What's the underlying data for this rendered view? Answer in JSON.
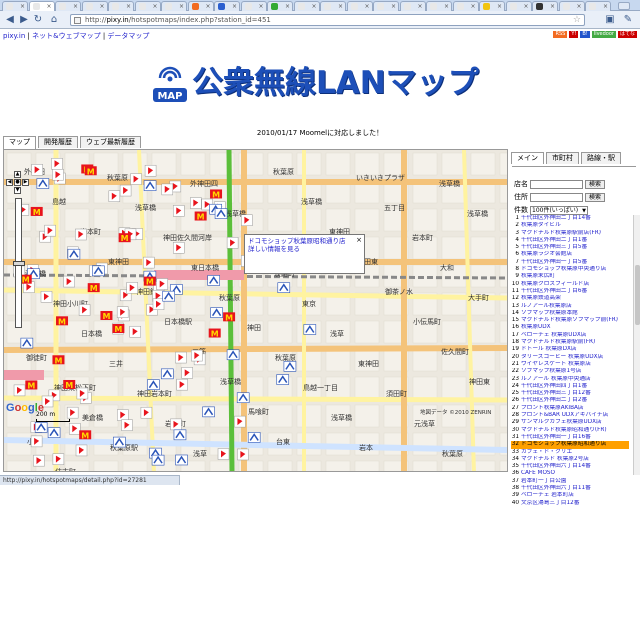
{
  "browser": {
    "tab_favicon_colors": [
      "#e8e8e8",
      "#e8e8e8",
      "#e8e8e8",
      "#e8e8e8",
      "#e8e8e8",
      "#e8e8e8",
      "#e8e8e8",
      "#f26b21",
      "#2b5fcf",
      "#e8e8e8",
      "#33aa33",
      "#e8e8e8",
      "#e8e8e8",
      "#e8e8e8",
      "#e8e8e8",
      "#e8e8e8",
      "#e8e8e8",
      "#e8e8e8",
      "#f1c40f",
      "#e8e8e8",
      "#333333",
      "#e8e8e8",
      "#e8e8e8"
    ],
    "active_tab_index": 1,
    "url_prefix": "http://",
    "url_host": "pixy.in",
    "url_path": "/hotspotmaps/index.php?station_id=451",
    "status_url": "http://pixy.in/hotspotmaps/detail.php?id=27281"
  },
  "site": {
    "links": [
      "pixy.in",
      "ネット&ウェブマップ",
      "データマップ"
    ],
    "badges": [
      {
        "label": "RSS",
        "color": "#f26b21"
      },
      {
        "label": "Y!",
        "color": "#cc0000"
      },
      {
        "label": "B!",
        "color": "#2255cc"
      },
      {
        "label": "livedoor",
        "color": "#44aa44"
      },
      {
        "label": "はてな",
        "color": "#cc0000"
      }
    ],
    "logo_badge": "MAP",
    "title": "公衆無線LANマップ",
    "notice": "2010/01/17 Moomelに対応しました！",
    "tabs": [
      "マップ",
      "開発履歴",
      "ウェブ最新履歴"
    ]
  },
  "map": {
    "infowindow": {
      "line1": "ドコモショップ秋葉原昭和通り店",
      "line2": "詳しい情報を見る",
      "close": "×"
    },
    "labels": [
      "外神田",
      "秋葉原",
      "外神田四",
      "秋葉原",
      "いきいきプラザ",
      "浅草橋",
      "島越",
      "浅草橋",
      "東浅草橋",
      "浅草橋",
      "五丁目",
      "浅草橋",
      "岩本町",
      "神田佐久間河岸",
      "神田岩本町",
      "東神田",
      "岩本町",
      "浅草橋",
      "東神田",
      "東日本橋",
      "淡路町",
      "神田東",
      "大和",
      "神田小川町",
      "神田錦町",
      "秋葉原",
      "東京",
      "御茶ノ水",
      "大手町",
      "日本橋",
      "日本橋駅",
      "神田",
      "浅草",
      "小伝馬町",
      "御徒町",
      "三井",
      "三筋",
      "秋葉原",
      "東神田",
      "佐久間町",
      "神田東松下町",
      "神田岩本町",
      "浅草橋",
      "鳥越一丁目",
      "須田町",
      "神田東",
      "美倉橋",
      "岩井町",
      "馬喰町",
      "浅草橋",
      "元浅草",
      "小島",
      "秋葉原駅",
      "浅草",
      "台東",
      "岩本",
      "秋葉原",
      "住吉町"
    ],
    "scale": "200 m",
    "google": "Google",
    "copyright": "地図データ ©2010 ZENRIN"
  },
  "sidebar": {
    "tabs": [
      "メイン",
      "市町村",
      "路線・駅"
    ],
    "form": {
      "name_label": "店名",
      "addr_label": "住所",
      "search_button": "検索",
      "range_label": "件数",
      "range_value": "100件(いっぱい)"
    },
    "items": [
      "千代田区外神田二丁目14番",
      "秋葉原ダイビル",
      "マクドナルド秋葉原駅前店(FR)",
      "千代田区外神田二丁目1番",
      "千代田区外神田三丁目5番",
      "秋葉原ラジオ会館店",
      "千代田区外神田一丁目5番",
      "ドコモショップ秋葉原中央通り店",
      "秋葉原末広町",
      "秋葉原クロスフィールド店",
      "千代田区外神田二丁目6番",
      "秋葉原鉄道高架",
      "ルノアール秋葉原店",
      "ソフマップ秋葉原本館",
      "マクドナルド秋葉原ソフマップ前(FR)",
      "秋葉原UDX",
      "ベローチェ 秋葉原UDX店",
      "マクドナルド秋葉原駅前(FR)",
      "ドトール 秋葉原DX店",
      "タリーズコーヒー 秋葉原UDX店",
      "ワイヤレスゲート 秋葉原店",
      "ソフマップ秋葉原1号店",
      "ルノアール 秋葉原中央通店",
      "千代田区外神田四丁目1番",
      "千代田区外神田三丁目12番",
      "千代田区外神田二丁目2番",
      "プロント秋葉原AKIBA店",
      "プロント&BAR UDXアキバイチ店",
      "サンマルクカフェ秋葉原UDX店",
      "マクドナルド秋葉原昭和通り(FR)",
      "千代田区外神田一丁目16番",
      "ドコモショップ秋葉原昭和通り店",
      "カフェ・ド・クリエ",
      "マクドナルド 秋葉原2号店",
      "千代田区外神田六丁目14番",
      "CAFE MOSO",
      "岩本町一丁目公園",
      "千代田区外神田六丁目11番",
      "ベローチェ 岩本町店",
      "文京区湯島三丁目12番"
    ],
    "highlight_index": 31
  },
  "chart_colors": {
    "pin_red": "#e8141c",
    "pin_white": "#ffffff",
    "wifi_blue": "#2a54b8",
    "road_orange": "#f4c37a",
    "road_yellow": "#fff3a0",
    "rail_green": "#5bbf3a",
    "station_pink": "#f09aaa",
    "map_bg": "#ece8df"
  }
}
